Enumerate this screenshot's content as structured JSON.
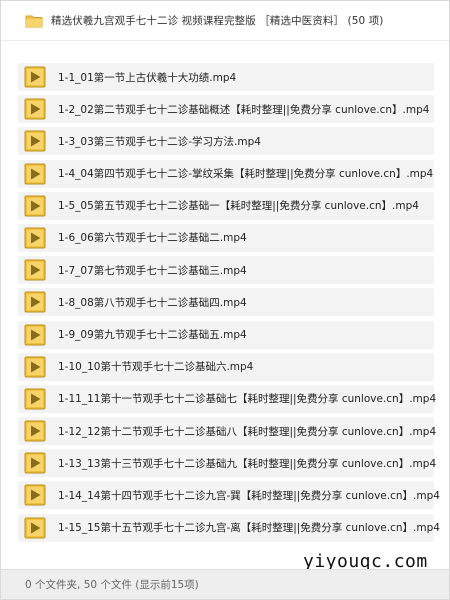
{
  "header": {
    "icon": "folder-icon",
    "title": "精选伏羲九宫观手七十二诊 视频课程完整版 ［精选中医资料］ (50 项)"
  },
  "files": [
    {
      "icon": "video-file-icon",
      "name": "1-1_01第一节上古伏羲十大功绩.mp4"
    },
    {
      "icon": "video-file-icon",
      "name": "1-2_02第二节观手七十二诊基础概述【耗时整理||免费分享 cunlove.cn】.mp4"
    },
    {
      "icon": "video-file-icon",
      "name": "1-3_03第三节观手七十二诊-学习方法.mp4"
    },
    {
      "icon": "video-file-icon",
      "name": "1-4_04第四节观手七十二诊-掌纹采集【耗时整理||免费分享 cunlove.cn】.mp4"
    },
    {
      "icon": "video-file-icon",
      "name": "1-5_05第五节观手七十二诊基础一【耗时整理||免费分享 cunlove.cn】.mp4"
    },
    {
      "icon": "video-file-icon",
      "name": "1-6_06第六节观手七十二诊基础二.mp4"
    },
    {
      "icon": "video-file-icon",
      "name": "1-7_07第七节观手七十二诊基础三.mp4"
    },
    {
      "icon": "video-file-icon",
      "name": "1-8_08第八节观手七十二诊基础四.mp4"
    },
    {
      "icon": "video-file-icon",
      "name": "1-9_09第九节观手七十二诊基础五.mp4"
    },
    {
      "icon": "video-file-icon",
      "name": "1-10_10第十节观手七十二诊基础六.mp4"
    },
    {
      "icon": "video-file-icon",
      "name": "1-11_11第十一节观手七十二诊基础七【耗时整理||免费分享 cunlove.cn】.mp4"
    },
    {
      "icon": "video-file-icon",
      "name": "1-12_12第十二节观手七十二诊基础八【耗时整理||免费分享 cunlove.cn】.mp4"
    },
    {
      "icon": "video-file-icon",
      "name": "1-13_13第十三节观手七十二诊基础九【耗时整理||免费分享 cunlove.cn】.mp4"
    },
    {
      "icon": "video-file-icon",
      "name": "1-14_14第十四节观手七十二诊九宫-巽【耗时整理||免费分享 cunlove.cn】.mp4"
    },
    {
      "icon": "video-file-icon",
      "name": "1-15_15第十五节观手七十二诊九宫-离【耗时整理||免费分享 cunlove.cn】.mp4"
    }
  ],
  "watermark": "yiyouqc.com",
  "footer": {
    "status": "0 个文件夹, 50 个文件 (显示前15项)"
  },
  "colors": {
    "folder": "#f2c14e",
    "file_icon_bg": "#f0c13a",
    "play_triangle": "#8a6d1a",
    "row_bg": "#f3f3f3"
  }
}
